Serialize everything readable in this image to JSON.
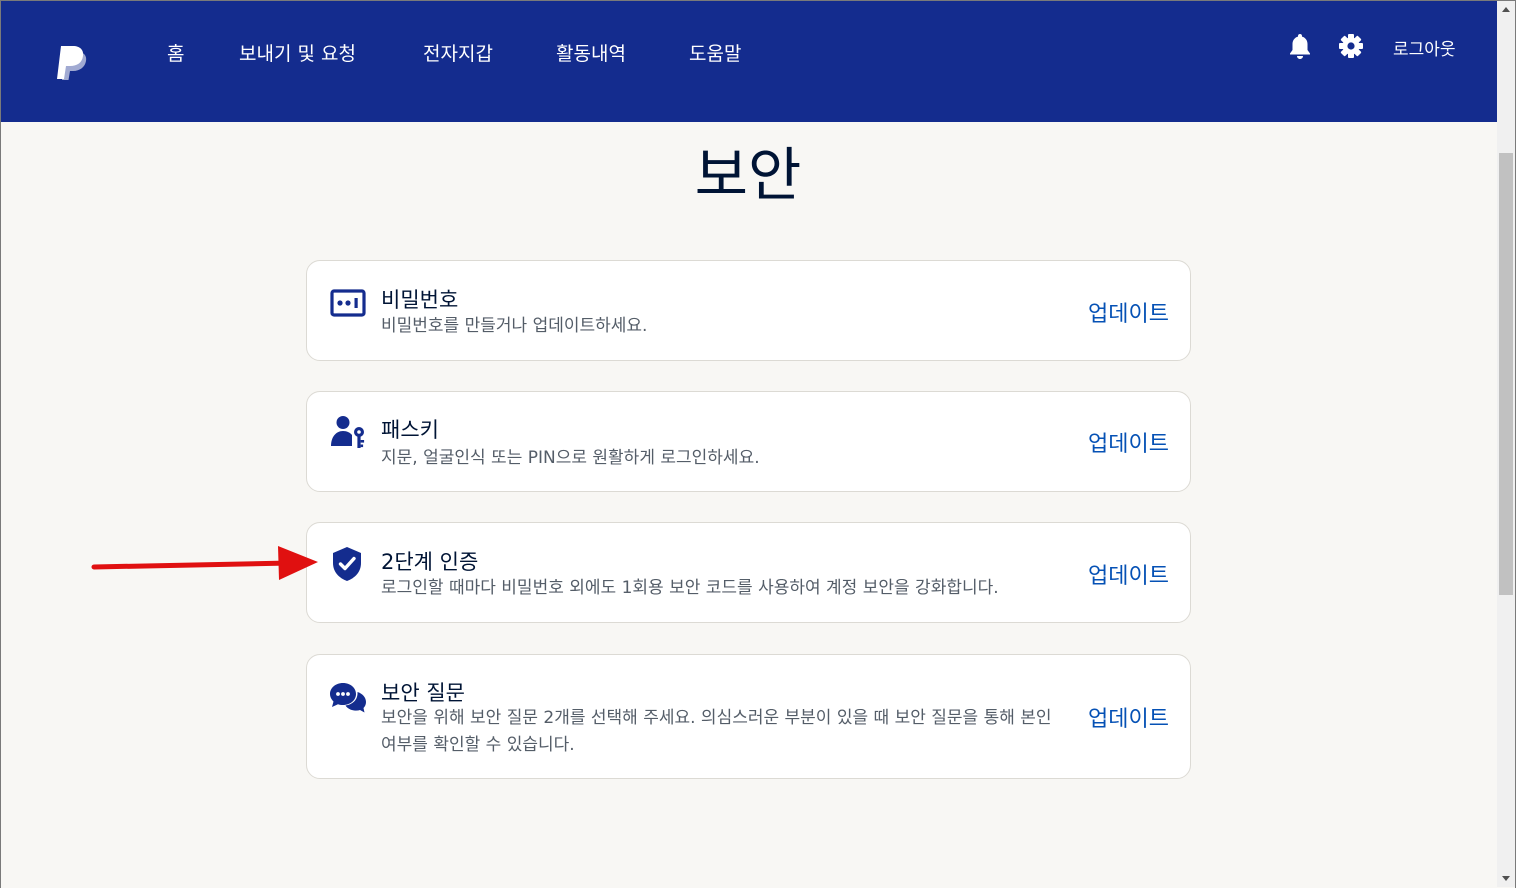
{
  "nav": {
    "logo_icon": "paypal-logo",
    "items": [
      "홈",
      "보내기 및 요청",
      "전자지갑",
      "활동내역",
      "도움말"
    ],
    "bell_icon": "bell-icon",
    "gear_icon": "gear-icon",
    "logout_label": "로그아웃"
  },
  "page": {
    "title": "보안"
  },
  "cards": [
    {
      "icon": "password-icon",
      "title": "비밀번호",
      "desc": "비밀번호를 만들거나 업데이트하세요.",
      "action": "업데이트"
    },
    {
      "icon": "passkey-icon",
      "title": "패스키",
      "desc": "지문, 얼굴인식 또는 PIN으로 원활하게 로그인하세요.",
      "action": "업데이트"
    },
    {
      "icon": "shield-check-icon",
      "title": "2단계 인증",
      "desc": "로그인할 때마다 비밀번호 외에도 1회용 보안 코드를 사용하여 계정 보안을 강화합니다.",
      "action": "업데이트"
    },
    {
      "icon": "chat-bubbles-icon",
      "title": "보안 질문",
      "desc": "보안을 위해 보안 질문 2개를 선택해 주세요. 의심스러운 부분이 있을 때 보안 질문을 통해 본인 여부를 확인할 수 있습니다.",
      "action": "업데이트"
    }
  ],
  "colors": {
    "header_bg": "#142c8e",
    "link": "#0551b5",
    "icon": "#142c8e",
    "annotation_arrow": "#e01010"
  }
}
